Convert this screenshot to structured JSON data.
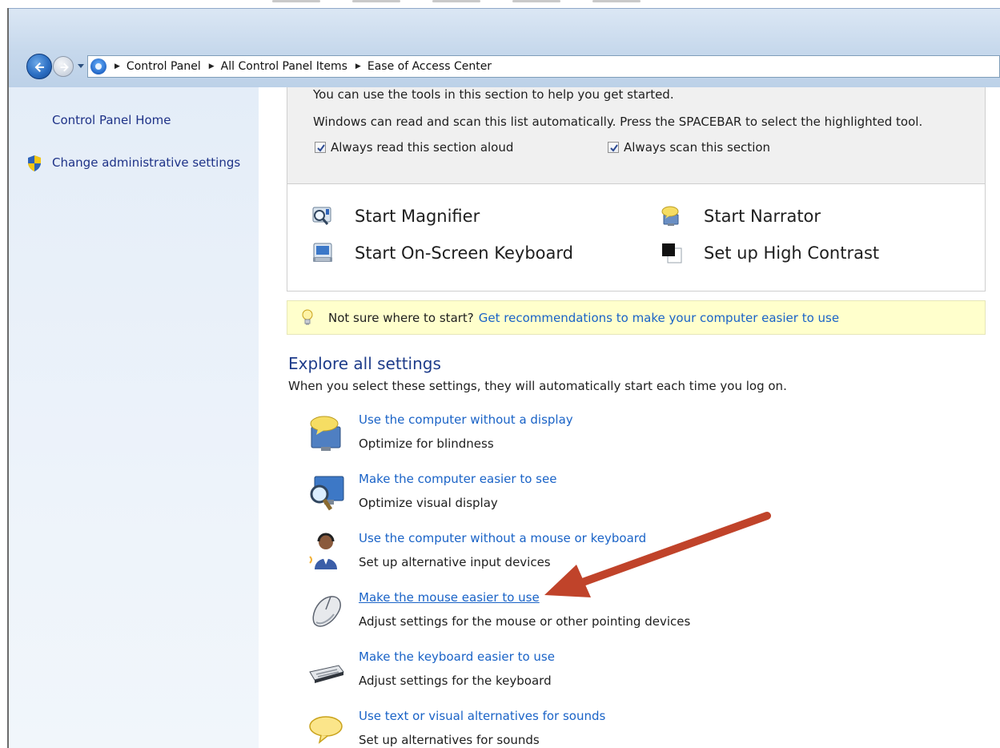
{
  "breadcrumb": {
    "items": [
      "Control Panel",
      "All Control Panel Items",
      "Ease of Access Center"
    ]
  },
  "left_pane": {
    "home_link": "Control Panel Home",
    "admin_link": "Change administrative settings"
  },
  "quick_access": {
    "line1": "You can use the tools in this section to help you get started.",
    "line2": "Windows can read and scan this list automatically.  Press the SPACEBAR to select the highlighted tool.",
    "checkbox_read": {
      "label": "Always read this section aloud",
      "checked": true
    },
    "checkbox_scan": {
      "label": "Always scan this section",
      "checked": true
    }
  },
  "tools": {
    "magnifier": "Start Magnifier",
    "narrator": "Start Narrator",
    "onscreen_keyboard": "Start On-Screen Keyboard",
    "high_contrast": "Set up High Contrast"
  },
  "hint": {
    "text": "Not sure where to start?",
    "link": "Get recommendations to make your computer easier to use"
  },
  "explore": {
    "title": "Explore all settings",
    "subtitle": "When you select these settings, they will automatically start each time you log on.",
    "items": [
      {
        "link": "Use the computer without a display",
        "desc": "Optimize for blindness",
        "icon": "display-speech-icon"
      },
      {
        "link": "Make the computer easier to see",
        "desc": "Optimize visual display",
        "icon": "magnifier-monitor-icon"
      },
      {
        "link": "Use the computer without a mouse or keyboard",
        "desc": "Set up alternative input devices",
        "icon": "headset-user-icon"
      },
      {
        "link": "Make the mouse easier to use",
        "desc": "Adjust settings for the mouse or other pointing devices",
        "icon": "mouse-icon"
      },
      {
        "link": "Make the keyboard easier to use",
        "desc": "Adjust settings for the keyboard",
        "icon": "keyboard-icon"
      },
      {
        "link": "Use text or visual alternatives for sounds",
        "desc": "Set up alternatives for sounds",
        "icon": "speech-bubble-icon"
      }
    ]
  },
  "colors": {
    "link": "#1a63c7",
    "heading": "#1e3c8a",
    "hint_background": "#ffffcc",
    "annotation_arrow": "#c0432a"
  }
}
